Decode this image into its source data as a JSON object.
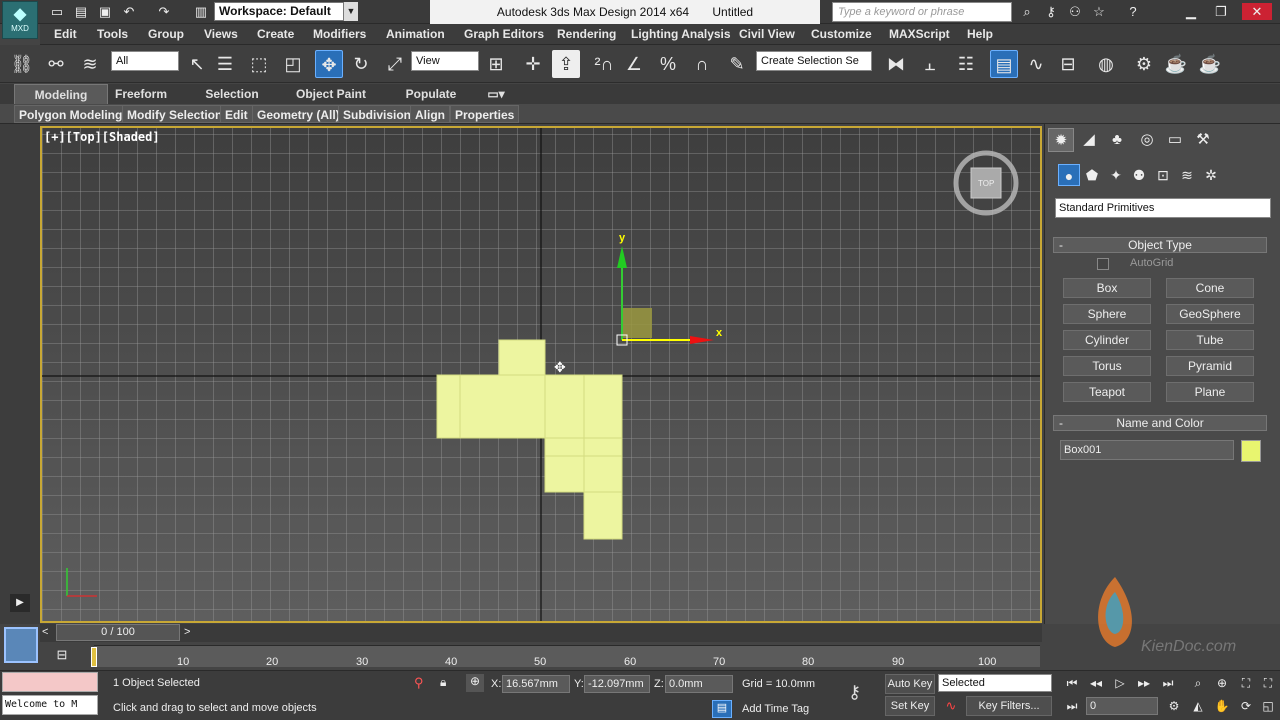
{
  "quick_access": {
    "icons": [
      "new-icon",
      "open-icon",
      "save-icon",
      "undo-icon",
      "redo-icon",
      "project-folder-icon"
    ]
  },
  "workspace": {
    "label": "Workspace: Default"
  },
  "title": {
    "app": "Autodesk 3ds Max Design 2014 x64",
    "file": "Untitled"
  },
  "search": {
    "placeholder": "Type a keyword or phrase"
  },
  "logo": {
    "text": "MXD"
  },
  "menu": {
    "items": [
      "Edit",
      "Tools",
      "Group",
      "Views",
      "Create",
      "Modifiers",
      "Animation",
      "Graph Editors",
      "Rendering",
      "Lighting Analysis",
      "Civil View",
      "Customize",
      "MAXScript",
      "Help"
    ]
  },
  "toolbar": {
    "filter": "All",
    "ref_coord": "View",
    "named_sel": "Create Selection Se"
  },
  "ribbon": {
    "tabs": [
      "Modeling",
      "Freeform",
      "Selection",
      "Object Paint",
      "Populate"
    ],
    "subtabs": [
      "Polygon Modeling",
      "Modify Selection",
      "Edit",
      "Geometry (All)",
      "Subdivision",
      "Align",
      "Properties"
    ]
  },
  "viewport": {
    "label": "[+][Top][Shaded]",
    "gizmo_x": "x",
    "gizmo_y": "y",
    "viewcube_label": "TOP"
  },
  "command_panel": {
    "category": "Standard Primitives",
    "object_type_title": "Object Type",
    "autogrid": "AutoGrid",
    "buttons": [
      "Box",
      "Cone",
      "Sphere",
      "GeoSphere",
      "Cylinder",
      "Tube",
      "Torus",
      "Pyramid",
      "Teapot",
      "Plane"
    ],
    "name_color_title": "Name and Color",
    "object_name": "Box001",
    "object_color": "#e8f56f"
  },
  "timeline": {
    "frame_display": "0 / 100",
    "ticks": [
      "10",
      "20",
      "30",
      "40",
      "50",
      "60",
      "70",
      "80",
      "90",
      "100"
    ]
  },
  "status": {
    "listener": "Welcome to M",
    "selection": "1 Object Selected",
    "prompt": "Click and drag to select and move objects",
    "x_label": "X:",
    "x_value": "16.567mm",
    "y_label": "Y:",
    "y_value": "-12.097mm",
    "z_label": "Z:",
    "z_value": "0.0mm",
    "grid": "Grid = 10.0mm",
    "auto_key": "Auto Key",
    "set_key": "Set Key",
    "key_mode": "Selected",
    "key_filters": "Key Filters...",
    "add_time_tag": "Add Time Tag",
    "frame": "0"
  },
  "watermark": {
    "text": "KienDoc.com"
  },
  "colors": {
    "viewport_border": "#c8a835",
    "accent_blue": "#2a6fb8",
    "object_fill": "#edf5a0"
  }
}
